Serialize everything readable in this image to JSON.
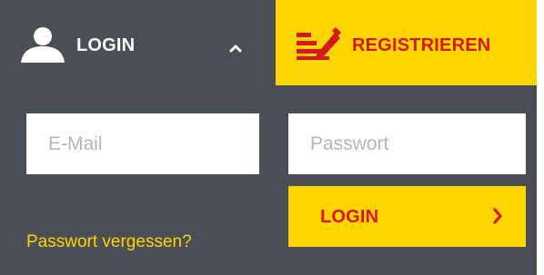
{
  "tabs": {
    "login_label": "LOGIN",
    "register_label": "REGISTRIEREN"
  },
  "fields": {
    "email_placeholder": "E-Mail",
    "password_placeholder": "Passwort"
  },
  "actions": {
    "login_button_label": "LOGIN",
    "forgot_password_link": "Passwort vergessen?"
  },
  "icons": {
    "login_tab": "user-icon",
    "collapse": "chevron-up-icon",
    "register_tab": "edit-icon",
    "login_button": "chevron-right-icon"
  },
  "colors": {
    "panel_background": "#4a4f55",
    "accent_yellow": "#ffd400",
    "accent_red": "#d61a1a",
    "text_white": "#ffffff",
    "placeholder_grey": "#b6b6b6"
  }
}
